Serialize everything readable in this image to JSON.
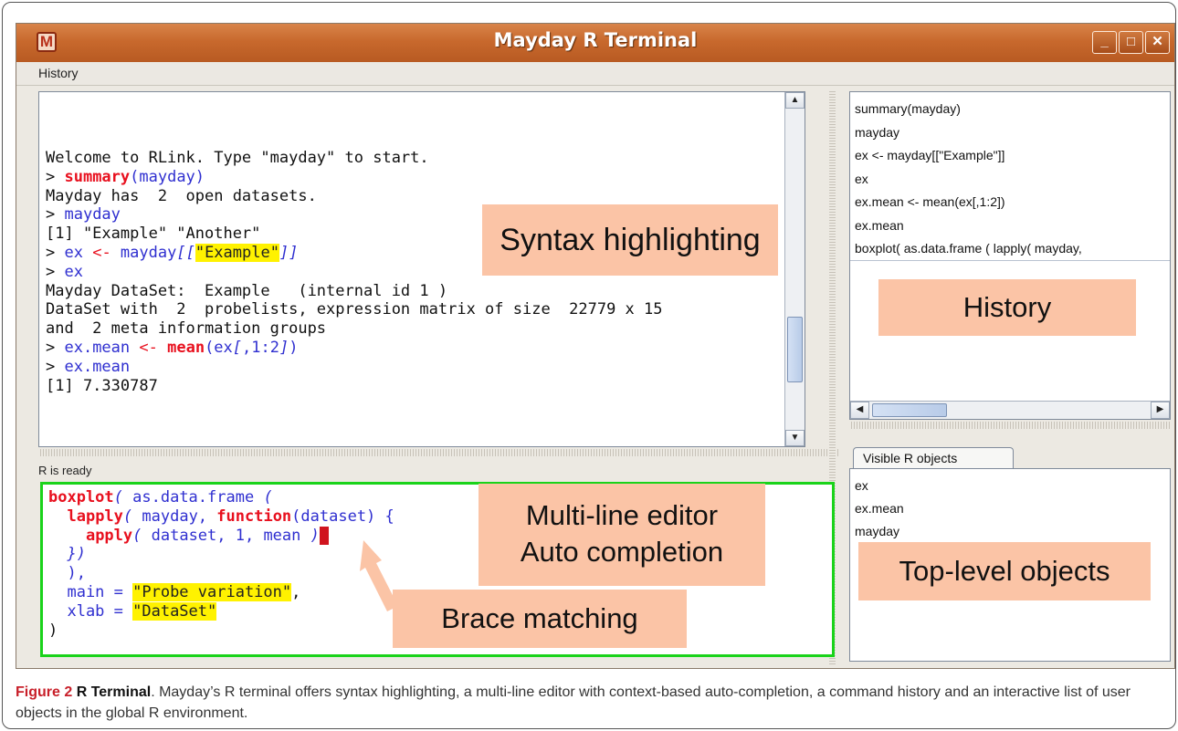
{
  "window": {
    "title": "Mayday R Terminal",
    "app_icon": "M"
  },
  "menu": {
    "history": "History"
  },
  "console": {
    "lines": [
      [
        {
          "t": "Welcome to RLink. Type \"mayday\" to start.",
          "c": ""
        }
      ],
      [
        {
          "t": "> ",
          "c": ""
        },
        {
          "t": "summary",
          "c": "kw"
        },
        {
          "t": "(mayday)",
          "c": "fn"
        }
      ],
      [
        {
          "t": "Mayday has  2  open datasets.",
          "c": ""
        }
      ],
      [
        {
          "t": "> ",
          "c": ""
        },
        {
          "t": "mayday",
          "c": "fn"
        }
      ],
      [
        {
          "t": "[1] \"Example\" \"Another\"",
          "c": ""
        }
      ],
      [
        {
          "t": "> ",
          "c": ""
        },
        {
          "t": "ex ",
          "c": "fn"
        },
        {
          "t": "<-",
          "c": "op"
        },
        {
          "t": " mayday",
          "c": "fn"
        },
        {
          "t": "[[",
          "c": "it"
        },
        {
          "t": "\"Example\"",
          "c": "st"
        },
        {
          "t": "]]",
          "c": "it"
        }
      ],
      [
        {
          "t": "> ",
          "c": ""
        },
        {
          "t": "ex",
          "c": "fn"
        }
      ],
      [
        {
          "t": "Mayday DataSet:  Example   (internal id 1 )",
          "c": ""
        }
      ],
      [
        {
          "t": "DataSet with  2  probelists, expression matrix of size  22779 x 15",
          "c": ""
        }
      ],
      [
        {
          "t": "and  2 meta information groups",
          "c": ""
        }
      ],
      [
        {
          "t": "> ",
          "c": ""
        },
        {
          "t": "ex.mean ",
          "c": "fn"
        },
        {
          "t": "<-",
          "c": "op"
        },
        {
          "t": " ",
          "c": ""
        },
        {
          "t": "mean",
          "c": "kw"
        },
        {
          "t": "(ex",
          "c": "fn"
        },
        {
          "t": "[",
          "c": "it"
        },
        {
          "t": ",1:2",
          "c": "fn"
        },
        {
          "t": "]",
          "c": "it"
        },
        {
          "t": ")",
          "c": "fn"
        }
      ],
      [
        {
          "t": "> ",
          "c": ""
        },
        {
          "t": "ex.mean",
          "c": "fn"
        }
      ],
      [
        {
          "t": "[1] 7.330787",
          "c": ""
        }
      ]
    ]
  },
  "status": "R is ready",
  "editor": {
    "lines": [
      [
        {
          "t": "boxplot",
          "c": "kw"
        },
        {
          "t": "( ",
          "c": "it"
        },
        {
          "t": "as.data.frame",
          "c": "fn"
        },
        {
          "t": " (",
          "c": "it"
        }
      ],
      [
        {
          "t": "  ",
          "c": ""
        },
        {
          "t": "lapply",
          "c": "kw"
        },
        {
          "t": "( ",
          "c": "it"
        },
        {
          "t": "mayday, ",
          "c": "fn"
        },
        {
          "t": "function",
          "c": "kw"
        },
        {
          "t": "(dataset) {",
          "c": "fn"
        }
      ],
      [
        {
          "t": "    ",
          "c": ""
        },
        {
          "t": "apply",
          "c": "kw"
        },
        {
          "t": "( ",
          "c": "it"
        },
        {
          "t": "dataset, 1, mean ",
          "c": "fn"
        },
        {
          "t": ")",
          "c": "it"
        },
        {
          "t": ")",
          "c": "caret"
        }
      ],
      [
        {
          "t": "  })",
          "c": "it"
        }
      ],
      [
        {
          "t": "  ),",
          "c": "fn"
        }
      ],
      [
        {
          "t": "  main = ",
          "c": "fn"
        },
        {
          "t": "\"Probe variation\"",
          "c": "st"
        },
        {
          "t": ",",
          "c": ""
        }
      ],
      [
        {
          "t": "  xlab = ",
          "c": "fn"
        },
        {
          "t": "\"DataSet\"",
          "c": "st"
        }
      ],
      [
        {
          "t": ")",
          "c": ""
        }
      ]
    ]
  },
  "history": {
    "items": [
      "summary(mayday)",
      "mayday",
      "ex <- mayday[[\"Example\"]]",
      "ex",
      "ex.mean <- mean(ex[,1:2])",
      "ex.mean",
      "boxplot( as.data.frame ( lapply( mayday,"
    ]
  },
  "objects": {
    "tab_label": "Visible R objects",
    "items": [
      "ex",
      "ex.mean",
      "mayday"
    ]
  },
  "callouts": {
    "syntax": "Syntax highlighting",
    "history": "History",
    "editor_1": "Multi-line editor",
    "editor_2": "Auto completion",
    "brace": "Brace matching",
    "objects": "Top-level objects"
  },
  "caption": {
    "label": "Figure 2",
    "title": "R Terminal",
    "text": ". Mayday’s R terminal offers syntax highlighting, a multi-line editor with context-based auto-completion, a command history and an interactive list of user objects in the global R environment."
  },
  "colors": {
    "title_bar": "#c8692d",
    "editor_border": "#1ad31a",
    "callout": "#fbc4a6",
    "keyword": "#e8101e",
    "identifier": "#2f2fd0",
    "string_highlight": "#fff200"
  },
  "icons": {
    "minimize": "minimize-icon",
    "maximize": "maximize-icon",
    "close": "close-icon"
  }
}
